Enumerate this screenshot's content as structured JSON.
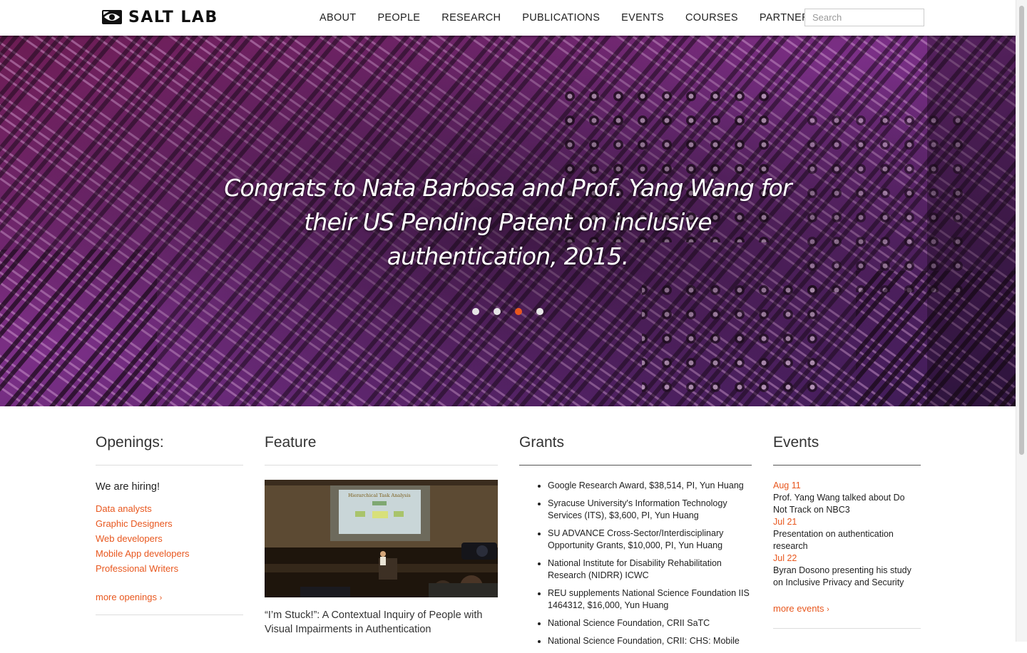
{
  "site": {
    "logo_text": "SALT LAB",
    "accent": "#e8571e"
  },
  "nav": {
    "items": [
      "ABOUT",
      "PEOPLE",
      "RESEARCH",
      "PUBLICATIONS",
      "EVENTS",
      "COURSES",
      "PARTNERSHIPS"
    ],
    "search_placeholder": "Search"
  },
  "hero": {
    "caption": "Congrats to Nata Barbosa and Prof. Yang Wang for their US Pending Patent on inclusive authentication, 2015.",
    "slide_count": 4,
    "active_slide": 3
  },
  "openings": {
    "heading": "Openings:",
    "hiring": "We are hiring!",
    "items": [
      "Data analysts",
      "Graphic Designers",
      "Web developers",
      "Mobile App developers",
      "Professional Writers"
    ],
    "more": "more openings"
  },
  "feature": {
    "heading": "Feature",
    "slide_title": "Hierarchical Task Analysis",
    "title": "“I’m Stuck!”: A Contextual Inquiry of People with Visual Impairments in Authentication"
  },
  "grants": {
    "heading": "Grants",
    "items": [
      "Google Research Award, $38,514, PI, Yun Huang",
      "Syracuse University's Information Technology Services (ITS), $3,600, PI, Yun Huang",
      "SU ADVANCE Cross-Sector/Interdisciplinary Opportunity Grants, $10,000, PI, Yun Huang",
      "National Institute for Disability Rehabilitation Research (NIDRR) ICWC",
      "REU supplements National Science Foundation IIS 1464312, $16,000, Yun Huang",
      "National Science Foundation, CRII SaTC",
      "National Science Foundation, CRII: CHS: Mobile"
    ]
  },
  "events": {
    "heading": "Events",
    "items": [
      {
        "date": "Aug 11",
        "text": "Prof. Yang Wang talked about Do Not Track on NBC3"
      },
      {
        "date": "Jul 21",
        "text": "Presentation on authentication research"
      },
      {
        "date": "Jul 22",
        "text": "Byran Dosono presenting his study on Inclusive Privacy and Security"
      }
    ],
    "more": "more events"
  }
}
